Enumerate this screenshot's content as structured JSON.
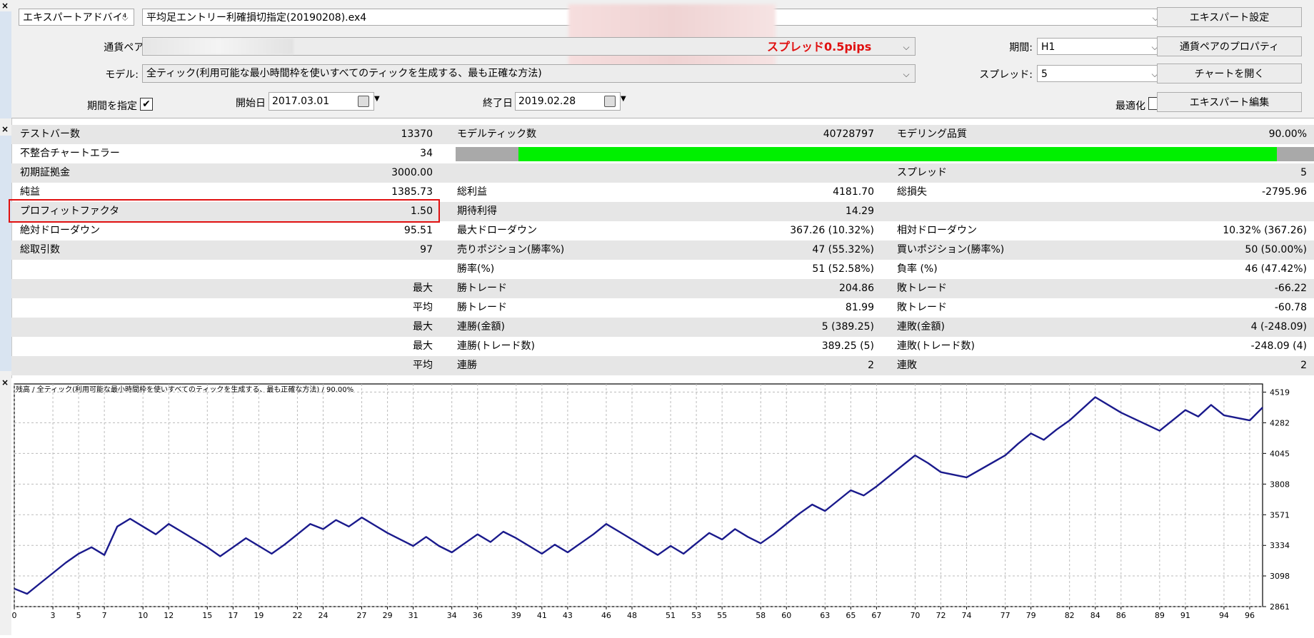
{
  "settings": {
    "expert_type": "エキスパートアドバイ⁴",
    "expert_file": "平均足エントリー利確損切指定(20190208).ex4",
    "symbol_label": "通貨ペア:",
    "spread_note": "スプレッド0.5pips",
    "period_label": "期間:",
    "period_value": "H1",
    "model_label": "モデル:",
    "model_value": "全ティック(利用可能な最小時間枠を使いすべてのティックを生成する、最も正確な方法)",
    "spread_label": "スプレッド:",
    "spread_value": "5",
    "use_date_label": "期間を指定",
    "use_date_checked": "✔",
    "start_label": "開始日",
    "start_value": "2017.03.01",
    "end_label": "終了日",
    "end_value": "2019.02.28",
    "optimize_label": "最適化",
    "buttons": {
      "expert_settings": "エキスパート設定",
      "symbol_props": "通貨ペアのプロパティ",
      "open_chart": "チャートを開く",
      "edit_expert": "エキスパート編集"
    }
  },
  "report": {
    "bars_label": "テストバー数",
    "bars_value": "13370",
    "ticks_label": "モデルティック数",
    "ticks_value": "40728797",
    "quality_label": "モデリング品質",
    "quality_value": "90.00%",
    "mismatch_label": "不整合チャートエラー",
    "mismatch_value": "34",
    "quality_fill": 0.95,
    "deposit_label": "初期証拠金",
    "deposit_value": "3000.00",
    "spread_label": "スプレッド",
    "spread_value": "5",
    "net_label": "純益",
    "net_value": "1385.73",
    "gross_profit_label": "総利益",
    "gross_profit_value": "4181.70",
    "gross_loss_label": "総損失",
    "gross_loss_value": "-2795.96",
    "pf_label": "プロフィットファクタ",
    "pf_value": "1.50",
    "expected_label": "期待利得",
    "expected_value": "14.29",
    "abs_dd_label": "絶対ドローダウン",
    "abs_dd_value": "95.51",
    "max_dd_label": "最大ドローダウン",
    "max_dd_value": "367.26 (10.32%)",
    "rel_dd_label": "相対ドローダウン",
    "rel_dd_value": "10.32% (367.26)",
    "trades_label": "総取引数",
    "trades_value": "97",
    "short_label": "売りポジション(勝率%)",
    "short_value": "47 (55.32%)",
    "long_label": "買いポジション(勝率%)",
    "long_value": "50 (50.00%)",
    "win_label": "勝率(%)",
    "win_value": "51 (52.58%)",
    "loss_label": "負率 (%)",
    "loss_value": "46 (47.42%)",
    "largest": "最大",
    "average": "平均",
    "win_trade_label": "勝トレード",
    "loss_trade_label": "敗トレード",
    "largest_win": "204.86",
    "largest_loss": "-66.22",
    "avg_win": "81.99",
    "avg_loss": "-60.78",
    "cons_win_amt_label": "連勝(金額)",
    "cons_win_amt": "5 (389.25)",
    "cons_loss_amt_label": "連敗(金額)",
    "cons_loss_amt": "4 (-248.09)",
    "cons_win_cnt_label": "連勝(トレード数)",
    "cons_win_cnt": "389.25 (5)",
    "cons_loss_cnt_label": "連敗(トレード数)",
    "cons_loss_cnt": "-248.09 (4)",
    "avg_cons_win_label": "連勝",
    "avg_cons_win": "2",
    "avg_cons_loss_label": "連敗",
    "avg_cons_loss": "2"
  },
  "chart_data": {
    "type": "line",
    "title": "残高 / 全ティック(利用可能な最小時間枠を使いすべてのティックを生成する、最も正確な方法) / 90.00%",
    "line_color": "#1a1a8c",
    "x_ticks": [
      0,
      3,
      5,
      7,
      10,
      12,
      15,
      17,
      19,
      22,
      24,
      27,
      29,
      31,
      34,
      36,
      39,
      41,
      43,
      46,
      48,
      51,
      53,
      55,
      58,
      60,
      63,
      65,
      67,
      70,
      72,
      74,
      77,
      79,
      82,
      84,
      86,
      89,
      91,
      94,
      96
    ],
    "y_ticks": [
      2861,
      3098,
      3334,
      3571,
      3808,
      4045,
      4282,
      4519
    ],
    "xlim": [
      0,
      97
    ],
    "ylim": [
      2861,
      4582
    ],
    "grid": true,
    "x": [
      0,
      1,
      2,
      3,
      4,
      5,
      6,
      7,
      8,
      9,
      10,
      11,
      12,
      13,
      14,
      15,
      16,
      17,
      18,
      19,
      20,
      21,
      22,
      23,
      24,
      25,
      26,
      27,
      28,
      29,
      30,
      31,
      32,
      33,
      34,
      35,
      36,
      37,
      38,
      39,
      40,
      41,
      42,
      43,
      44,
      45,
      46,
      47,
      48,
      49,
      50,
      51,
      52,
      53,
      54,
      55,
      56,
      57,
      58,
      59,
      60,
      61,
      62,
      63,
      64,
      65,
      66,
      67,
      68,
      69,
      70,
      71,
      72,
      74,
      77,
      78,
      79,
      80,
      81,
      82,
      84,
      86,
      89,
      90,
      91,
      92,
      93,
      94,
      96,
      97
    ],
    "y": [
      3000,
      2960,
      3040,
      3120,
      3200,
      3270,
      3320,
      3260,
      3480,
      3540,
      3480,
      3420,
      3500,
      3440,
      3380,
      3320,
      3250,
      3320,
      3390,
      3330,
      3270,
      3340,
      3420,
      3500,
      3460,
      3530,
      3480,
      3550,
      3490,
      3430,
      3380,
      3330,
      3400,
      3330,
      3280,
      3350,
      3420,
      3360,
      3440,
      3390,
      3330,
      3270,
      3340,
      3280,
      3350,
      3420,
      3500,
      3440,
      3380,
      3320,
      3260,
      3330,
      3270,
      3350,
      3430,
      3380,
      3460,
      3400,
      3350,
      3420,
      3500,
      3580,
      3650,
      3600,
      3680,
      3760,
      3720,
      3790,
      3870,
      3950,
      4030,
      3970,
      3900,
      3860,
      4030,
      4120,
      4200,
      4150,
      4230,
      4300,
      4480,
      4360,
      4220,
      4300,
      4380,
      4330,
      4420,
      4340,
      4300,
      4400
    ]
  }
}
